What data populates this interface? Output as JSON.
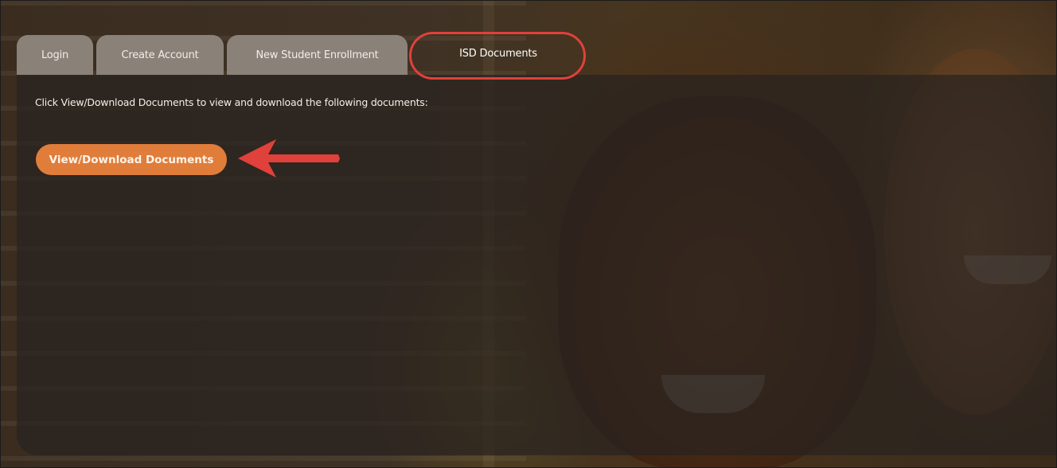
{
  "tabs": [
    {
      "label": "Login",
      "active": false
    },
    {
      "label": "Create Account",
      "active": false
    },
    {
      "label": "New Student Enrollment",
      "active": false
    },
    {
      "label": "ISD Documents",
      "active": true
    }
  ],
  "content": {
    "instructions": "Click View/Download Documents to view and download the following documents:",
    "view_button_label": "View/Download Documents"
  },
  "colors": {
    "accent_button": "#e07d3a",
    "annotation_red": "#e0413b",
    "tab_inactive": "#8a8179"
  },
  "icons": {
    "annotation_arrow": "left-arrow-icon",
    "annotation_ring": "highlight-ring"
  }
}
